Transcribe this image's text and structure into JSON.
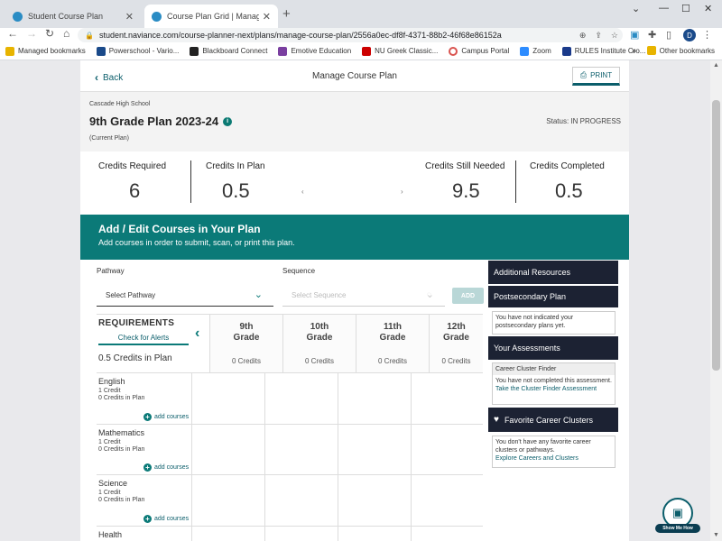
{
  "browser": {
    "tabs": [
      {
        "title": "Student Course Plan"
      },
      {
        "title": "Course Plan Grid | Manage Cour"
      }
    ],
    "url": "student.naviance.com/course-planner-next/plans/manage-course-plan/2556a0ec-df8f-4371-88b2-46f68e86152a",
    "profile_initial": "D",
    "bookmarks": [
      {
        "label": "Managed bookmarks",
        "color": "#e8b400"
      },
      {
        "label": "Powerschool - Vario...",
        "color": "#1a4a8a"
      },
      {
        "label": "Blackboard Connect",
        "color": "#222222"
      },
      {
        "label": "Emotive Education",
        "color": "#7a3fa0"
      },
      {
        "label": "NU Greek Classic...",
        "color": "#cc0000"
      },
      {
        "label": "Campus Portal",
        "color": "#d9534f"
      },
      {
        "label": "Zoom",
        "color": "#2d8cff"
      },
      {
        "label": "RULES Institute Cro...",
        "color": "#1a3a8a"
      }
    ],
    "other_bookmarks": "Other bookmarks"
  },
  "header": {
    "back_label": "Back",
    "title": "Manage Course Plan",
    "print_label": "PRINT"
  },
  "plan": {
    "school": "Cascade High School",
    "title": "9th Grade Plan 2023-24",
    "current": "(Current Plan)",
    "status": "Status: IN PROGRESS"
  },
  "credits": {
    "required": {
      "label": "Credits Required",
      "value": "6"
    },
    "in_plan": {
      "label": "Credits In Plan",
      "value": "0.5"
    },
    "still_needed": {
      "label": "Credits Still Needed",
      "value": "9.5"
    },
    "completed": {
      "label": "Credits Completed",
      "value": "0.5"
    }
  },
  "banner": {
    "title": "Add / Edit Courses in Your Plan",
    "subtitle": "Add courses in order to submit, scan, or print this plan."
  },
  "selectors": {
    "pathway_label": "Pathway",
    "pathway_value": "Select Pathway",
    "sequence_label": "Sequence",
    "sequence_value": "Select Sequence",
    "add_label": "ADD"
  },
  "grid": {
    "requirements_label": "REQUIREMENTS",
    "alerts_label": "Check for Alerts",
    "in_plan_label": "0.5 Credits in Plan",
    "grades": [
      {
        "line1": "9th",
        "line2": "Grade",
        "credits": "0 Credits"
      },
      {
        "line1": "10th",
        "line2": "Grade",
        "credits": "0 Credits"
      },
      {
        "line1": "11th",
        "line2": "Grade",
        "credits": "0 Credits"
      },
      {
        "line1": "12th",
        "line2": "Grade",
        "credits": "0 Credits"
      }
    ],
    "subjects": [
      {
        "name": "English",
        "credit": "1 Credit",
        "in_plan": "0 Credits in Plan",
        "add": "add courses"
      },
      {
        "name": "Mathematics",
        "credit": "1 Credit",
        "in_plan": "0 Credits in Plan",
        "add": "add courses"
      },
      {
        "name": "Science",
        "credit": "1 Credit",
        "in_plan": "0 Credits in Plan",
        "add": "add courses"
      },
      {
        "name": "Health",
        "credit": "",
        "in_plan": "",
        "add": ""
      }
    ]
  },
  "sidebar": {
    "additional_resources": "Additional Resources",
    "postsecondary_plan": "Postsecondary Plan",
    "postsecondary_text": "You have not indicated your postsecondary plans yet.",
    "assessments": "Your Assessments",
    "ccf_title": "Career Cluster Finder",
    "ccf_text": "You have not completed this assessment.",
    "ccf_link": "Take the Cluster Finder Assessment",
    "favorites": "Favorite Career Clusters",
    "favorites_text": "You don't have any favorite career clusters or pathways.",
    "favorites_link": "Explore Careers and Clusters"
  },
  "help": {
    "label": "Show Me How"
  }
}
